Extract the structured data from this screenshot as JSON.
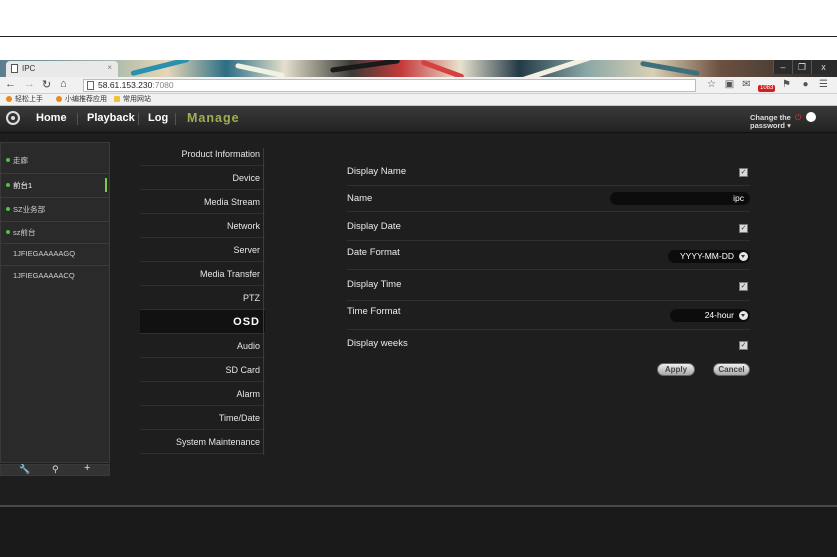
{
  "browser": {
    "tab_title": "IPC",
    "tab_close": "×",
    "address": {
      "host": "58.61.153.230",
      "port": ":7080"
    },
    "window_controls": {
      "minimize": "–",
      "restore": "❐",
      "close": "x"
    },
    "toolbar_icons": [
      "back-icon",
      "forward-icon",
      "reload-icon",
      "home-icon",
      "star-icon",
      "extensions-icon",
      "mail-icon",
      "notification-icon",
      "menu-icon"
    ],
    "mail_badge": "1083",
    "bookmarks": [
      "轻松上手",
      "小编推荐应用",
      "常用网站"
    ]
  },
  "app_nav": {
    "items": [
      "Home",
      "Playback",
      "Log",
      "Manage"
    ],
    "active": "Manage",
    "change_password_line1": "Change the",
    "change_password_line2": "password ▾"
  },
  "devices": {
    "items": [
      "走廊",
      "前台1",
      "SZ业务部",
      "sz前台",
      "1JFIEGAAAAAGQ",
      "1JFIEGAAAAACQ"
    ],
    "selected": "前台1",
    "footer_icons": [
      "wrench-icon",
      "search-icon",
      "plus-icon"
    ]
  },
  "settings_menu": {
    "items": [
      "Product Information",
      "Device",
      "Media Stream",
      "Network",
      "Server",
      "Media Transfer",
      "PTZ",
      "OSD",
      "Audio",
      "SD Card",
      "Alarm",
      "Time/Date",
      "System Maintenance"
    ],
    "active": "OSD"
  },
  "osd": {
    "display_name_label": "Display Name",
    "display_name_checked": true,
    "name_label": "Name",
    "name_value": "ipc",
    "display_date_label": "Display Date",
    "display_date_checked": true,
    "date_format_label": "Date Format",
    "date_format_value": "YYYY-MM-DD",
    "display_time_label": "Display Time",
    "display_time_checked": true,
    "time_format_label": "Time Format",
    "time_format_value": "24-hour",
    "display_weeks_label": "Display weeks",
    "display_weeks_checked": true,
    "checkmark": "✓",
    "apply_label": "Apply",
    "cancel_label": "Cancel"
  },
  "colors": {
    "accent": "#9fb04f",
    "online_dot": "#4ebe4e",
    "background": "#1e1e1e"
  }
}
